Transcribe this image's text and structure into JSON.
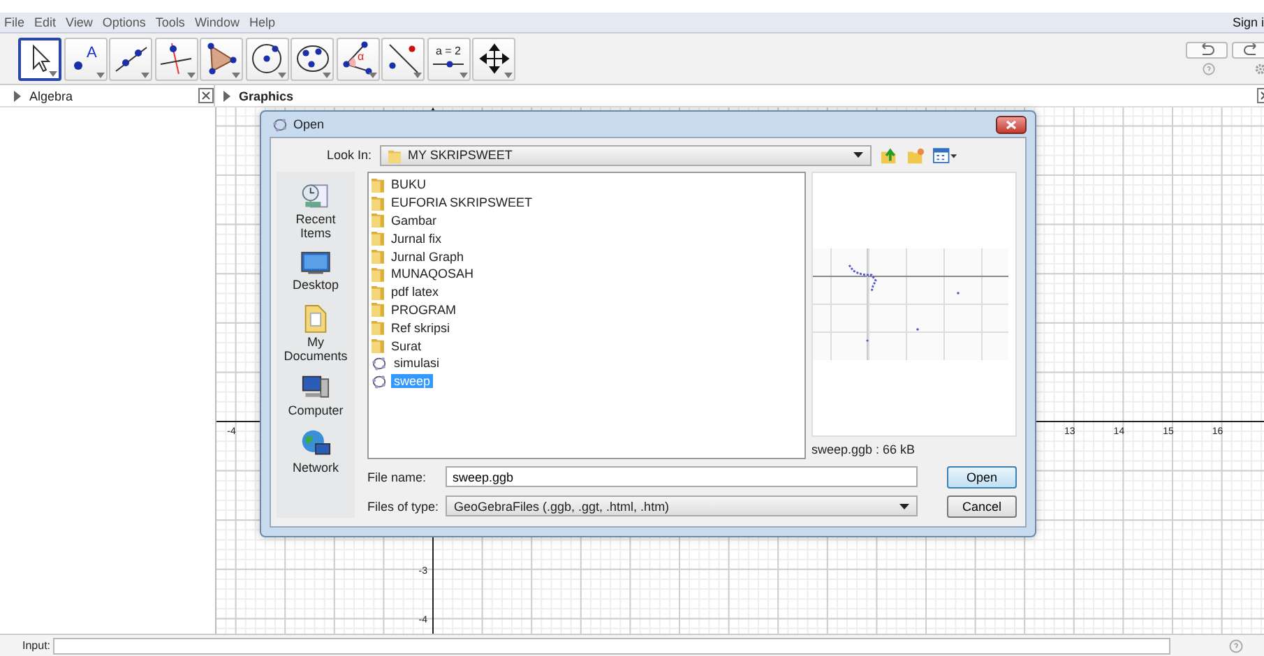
{
  "menu": [
    "File",
    "Edit",
    "View",
    "Options",
    "Tools",
    "Window",
    "Help"
  ],
  "sign_in": "Sign i",
  "toolbar": [
    {
      "kind": "move",
      "selected": true
    },
    {
      "kind": "point",
      "selected": false,
      "glyph": "A"
    },
    {
      "kind": "line",
      "selected": false
    },
    {
      "kind": "perpendicular",
      "selected": false
    },
    {
      "kind": "polygon",
      "selected": false
    },
    {
      "kind": "circle",
      "selected": false
    },
    {
      "kind": "conic",
      "selected": false
    },
    {
      "kind": "angle",
      "selected": false,
      "glyph": "α"
    },
    {
      "kind": "reflect",
      "selected": false
    },
    {
      "kind": "slider",
      "selected": false,
      "glyph": "a = 2"
    },
    {
      "kind": "move_view",
      "selected": false
    }
  ],
  "panels": [
    {
      "title": "Algebra"
    },
    {
      "title": "Graphics"
    }
  ],
  "graphics": {
    "x_labels": [
      "-4",
      "13",
      "14",
      "15",
      "16"
    ],
    "y_labels": [
      "-3",
      "-4"
    ]
  },
  "dialog": {
    "title": "Open",
    "look_in_label": "Look In:",
    "look_in": "MY SKRIPSWEET",
    "places": [
      {
        "kind": "recent",
        "label": "Recent Items"
      },
      {
        "kind": "desktop",
        "label": "Desktop"
      },
      {
        "kind": "documents",
        "label": "My Documents"
      },
      {
        "kind": "computer",
        "label": "Computer"
      },
      {
        "kind": "network",
        "label": "Network"
      }
    ],
    "files": [
      {
        "kind": "folder",
        "name": "BUKU",
        "selected": false
      },
      {
        "kind": "folder",
        "name": "EUFORIA SKRIPSWEET",
        "selected": false
      },
      {
        "kind": "folder",
        "name": "Gambar",
        "selected": false
      },
      {
        "kind": "folder",
        "name": "Jurnal fix",
        "selected": false
      },
      {
        "kind": "folder",
        "name": "Jurnal Graph",
        "selected": false
      },
      {
        "kind": "folder",
        "name": "MUNAQOSAH",
        "selected": false
      },
      {
        "kind": "folder",
        "name": "pdf latex",
        "selected": false
      },
      {
        "kind": "folder",
        "name": "PROGRAM",
        "selected": false
      },
      {
        "kind": "folder",
        "name": "Ref skripsi",
        "selected": false
      },
      {
        "kind": "folder",
        "name": "Surat",
        "selected": false
      },
      {
        "kind": "ggb",
        "name": "simulasi",
        "selected": false
      },
      {
        "kind": "ggb",
        "name": "sweep",
        "selected": true
      }
    ],
    "preview_caption": "sweep.ggb : 66 kB",
    "file_name_label": "File name:",
    "file_name": "sweep.ggb",
    "file_type_label": "Files of type:",
    "file_type": "GeoGebraFiles (.ggb, .ggt, .html, .htm)",
    "buttons": [
      "Open",
      "Cancel"
    ]
  },
  "input": {
    "label": "Input:"
  }
}
